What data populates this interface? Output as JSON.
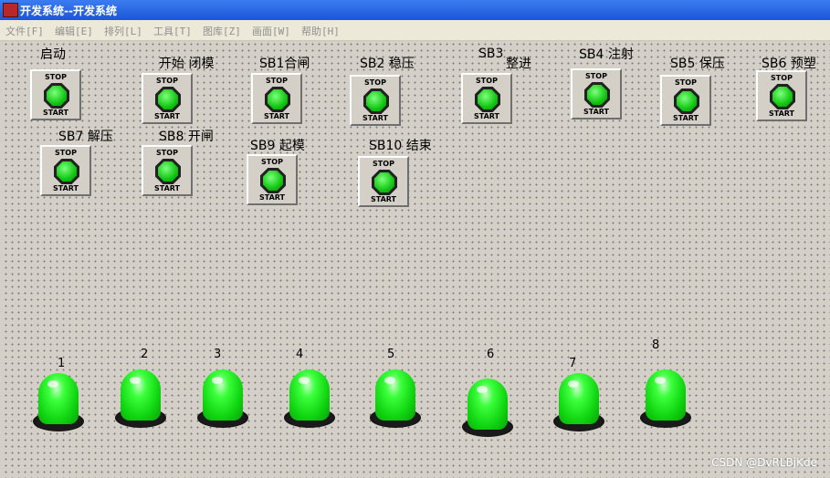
{
  "window": {
    "title": "开发系统--开发系统"
  },
  "menu": [
    "文件[F]",
    "编辑[E]",
    "排列[L]",
    "工具[T]",
    "图库[Z]",
    "画面[W]",
    "帮助[H]"
  ],
  "button_face": {
    "stop": "STOP",
    "start": "START"
  },
  "buttons": [
    {
      "id": "qidong",
      "label": "启动"
    },
    {
      "id": "start-close-mold",
      "label": "开始 闭模"
    },
    {
      "id": "sb1",
      "label": "SB1合闸"
    },
    {
      "id": "sb2",
      "label": "SB2 稳压"
    },
    {
      "id": "sb3",
      "label": "SB3",
      "label2": "整进"
    },
    {
      "id": "sb4",
      "label": "SB4 注射"
    },
    {
      "id": "sb5",
      "label": "SB5 保压"
    },
    {
      "id": "sb6",
      "label": "SB6 预塑"
    },
    {
      "id": "sb7",
      "label": "SB7 解压"
    },
    {
      "id": "sb8",
      "label": "SB8 开闸"
    },
    {
      "id": "sb9",
      "label": "SB9 起模"
    },
    {
      "id": "sb10",
      "label": "SB10 结束"
    }
  ],
  "lamps": [
    "1",
    "2",
    "3",
    "4",
    "5",
    "6",
    "7",
    "8"
  ],
  "lamp_color": "#10d410",
  "watermark": "CSDN @DvRLBjKde"
}
